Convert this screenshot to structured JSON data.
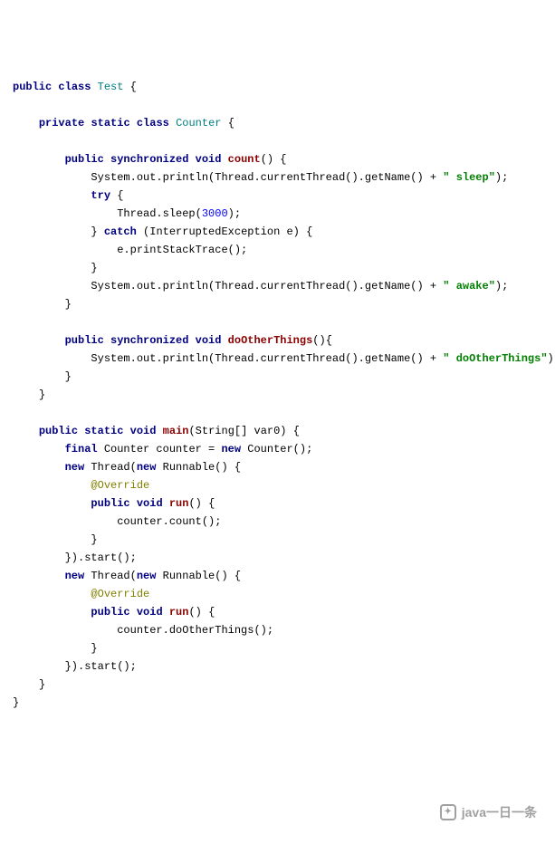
{
  "code": {
    "kw_public": "public",
    "kw_class": "class",
    "type_Test": "Test",
    "kw_private": "private",
    "kw_static": "static",
    "type_Counter": "Counter",
    "kw_synchronized": "synchronized",
    "kw_void": "void",
    "method_count": "count",
    "call_println_thread_getName": "System.out.println(Thread.currentThread().getName() + ",
    "str_sleep": "\" sleep\"",
    "close_paren_semi": ");",
    "kw_try": "try",
    "call_thread_sleep": "Thread.sleep(",
    "num_3000": "3000",
    "kw_catch": "catch",
    "catch_args": " (InterruptedException e) {",
    "call_printStackTrace": "e.printStackTrace();",
    "str_awake": "\" awake\"",
    "method_doOtherThings": "doOtherThings",
    "str_doOtherThings": "\" doOtherThings\"",
    "method_main": "main",
    "main_args": "(String[] var0) {",
    "kw_final": "final",
    "kw_new": "new",
    "counter_decl_eq": " Counter counter = ",
    "counter_ctor": " Counter();",
    "thread_ctor_open": " Thread(",
    "runnable_ctor_open": " Runnable() {",
    "ann_override": "@Override",
    "method_run": "run",
    "call_counter_count": "counter.count();",
    "call_counter_doOtherThings": "counter.doOtherThings();",
    "close_anon_start": "}).start();",
    "brace_open": " {",
    "brace_close": "}",
    "parens_brace": "() {",
    "parens_open_brace": "(){"
  },
  "watermark": {
    "text": "java一日一条"
  }
}
